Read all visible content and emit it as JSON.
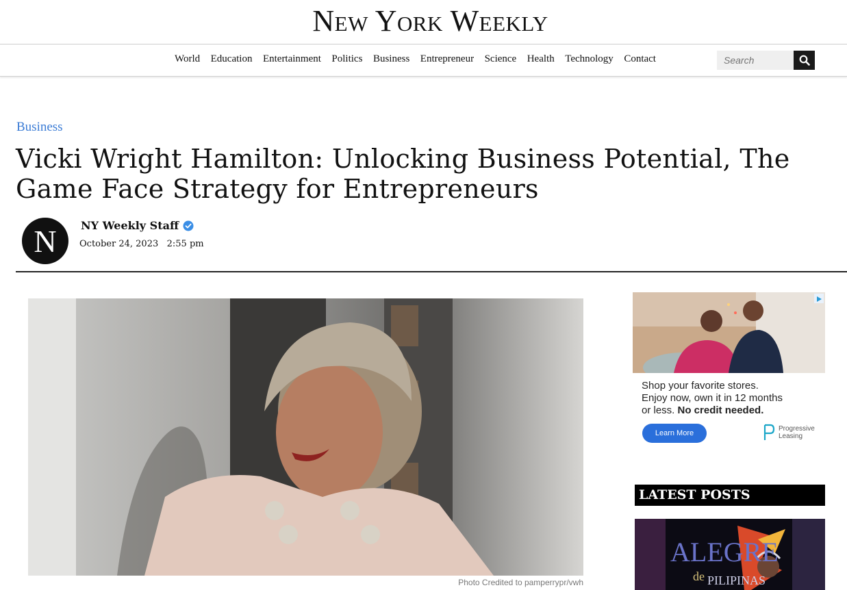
{
  "site": {
    "logo": "New York Weekly"
  },
  "nav": {
    "items": [
      "World",
      "Education",
      "Entertainment",
      "Politics",
      "Business",
      "Entrepreneur",
      "Science",
      "Health",
      "Technology",
      "Contact"
    ],
    "search_placeholder": "Search"
  },
  "article": {
    "category": "Business",
    "title": "Vicki Wright Hamilton: Unlocking Business Potential, The Game Face Strategy for Entrepreneurs",
    "author": "NY Weekly Staff",
    "avatar_letter": "N",
    "date": "October 24, 2023   2:55 pm",
    "photo_credit": "Photo Credited to pamperrypr/vwh"
  },
  "ad": {
    "line1": "Shop your favorite stores.",
    "line2": "Enjoy now, own it in 12 months",
    "line3_regular": "or less. ",
    "line3_bold": "No credit needed.",
    "button": "Learn More",
    "brand_line1": "Progressive",
    "brand_line2": "Leasing"
  },
  "sidebar": {
    "latest_heading": "LATEST POSTS",
    "post_thumb_text1": "ALEGRE",
    "post_thumb_text2": "de",
    "post_thumb_text3": "PILIPINAS"
  },
  "colors": {
    "accent": "#3a7bd5",
    "ad_button": "#2a6fdb",
    "heading_bg": "#000000"
  }
}
